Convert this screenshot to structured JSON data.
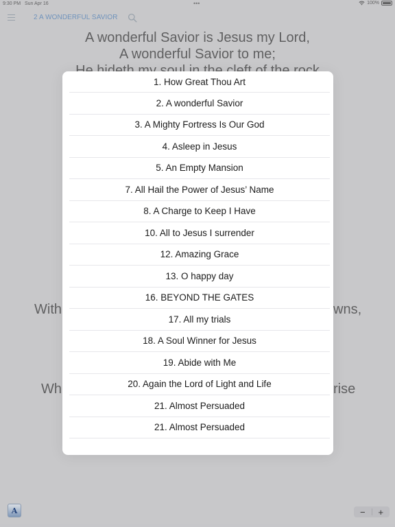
{
  "status_bar": {
    "time": "9:30 PM",
    "date": "Sun Apr 16",
    "dots": "•••",
    "battery": "100%"
  },
  "nav": {
    "title": "2 A WONDERFUL SAVIOR",
    "menu_icon": "hamburger-icon",
    "search_icon": "search-icon"
  },
  "lyrics": {
    "line1": "A wonderful Savior is Jesus my Lord,",
    "line2": "A wonderful Savior to me;",
    "line3": "He hideth my soul in the cleft of the rock",
    "partial_left_1": "With",
    "partial_right_1": "wns,",
    "partial_left_2": "Wh",
    "partial_right_2": "rise"
  },
  "hymn_list": [
    "1. How Great Thou Art",
    "2. A wonderful Savior",
    "3. A Mighty Fortress Is Our God",
    "4. Asleep in Jesus",
    "5. An Empty Mansion",
    "7. All Hail the Power of Jesus’ Name",
    "8. A Charge to Keep I Have",
    "10. All to Jesus I surrender",
    "12. Amazing Grace",
    "13. O happy day",
    "16. BEYOND THE GATES",
    "17. All my trials",
    "18. A Soul Winner for Jesus",
    "19. Abide with Me",
    "20. Again the Lord of Light and Life",
    "21. Almost Persuaded",
    "21. Almost Persuaded"
  ],
  "bottom": {
    "app_icon_letter": "A",
    "zoom_out": "−",
    "zoom_in": "+"
  },
  "colors": {
    "accent": "#2f6fb8",
    "background": "#cfcfd1",
    "modal": "#ffffff"
  }
}
